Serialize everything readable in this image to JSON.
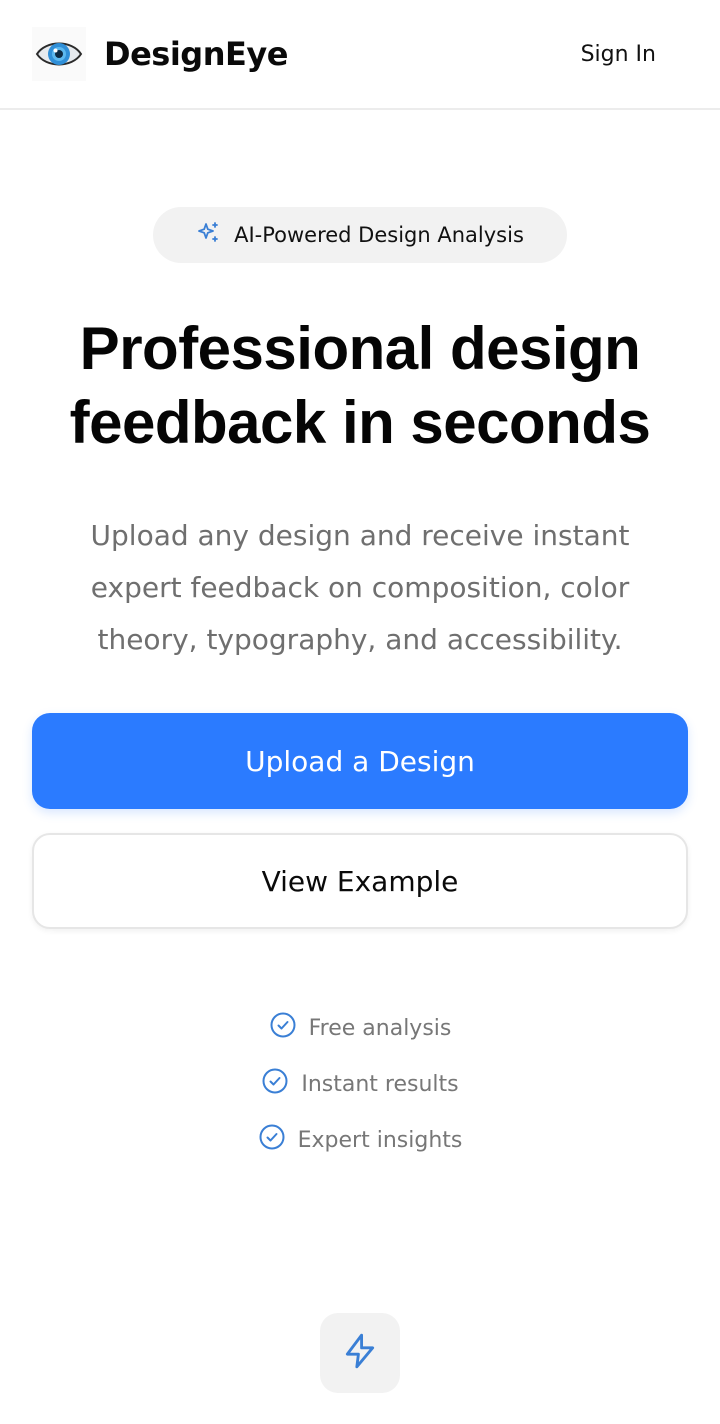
{
  "header": {
    "brand_name": "DesignEye",
    "logo_icon": "eye-icon",
    "sign_in_label": "Sign In"
  },
  "badge": {
    "icon": "sparkles-icon",
    "label": "AI-Powered Design Analysis"
  },
  "hero": {
    "title_line1": "Professional design",
    "title_line2": "feedback in seconds",
    "subtitle_line1": "Upload any design and receive instant",
    "subtitle_line2": "expert feedback on composition, color",
    "subtitle_line3": "theory, typography, and accessibility."
  },
  "actions": {
    "primary_label": "Upload a Design",
    "secondary_label": "View Example"
  },
  "features": [
    {
      "icon": "check-circle-icon",
      "label": "Free analysis"
    },
    {
      "icon": "check-circle-icon",
      "label": "Instant results"
    },
    {
      "icon": "check-circle-icon",
      "label": "Expert insights"
    }
  ],
  "bottom_tile": {
    "icon": "lightning-bolt-icon"
  },
  "colors": {
    "accent": "#2b7bff",
    "text": "#0a0a0a",
    "muted": "#6f6f6f",
    "chip_bg": "#f2f2f2",
    "icon_blue": "#3a7fd5"
  }
}
